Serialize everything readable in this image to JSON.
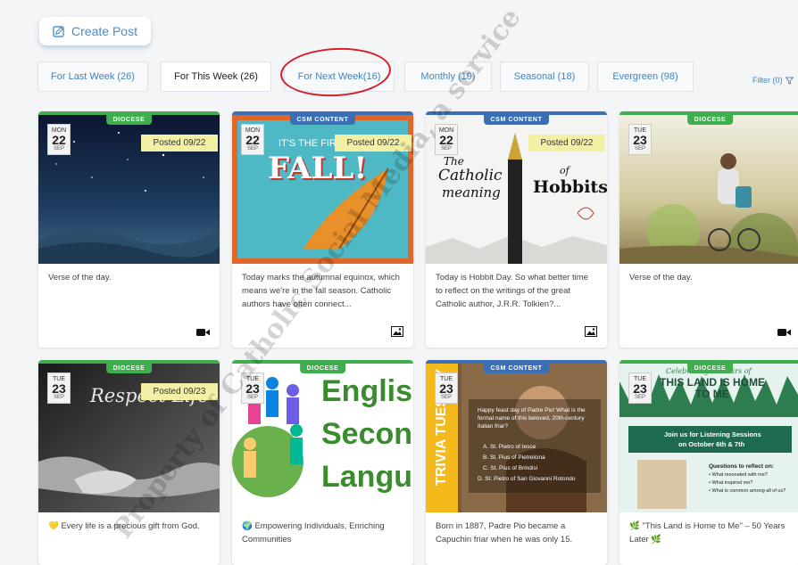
{
  "create_post": {
    "label": "Create Post",
    "icon": "edit-square-icon"
  },
  "tabs": [
    {
      "label": "For Last Week (26)",
      "active": false
    },
    {
      "label": "For This Week (26)",
      "active": true
    },
    {
      "label": "For Next Week(16)",
      "active": false,
      "circled": true
    },
    {
      "label": "Monthly (19)",
      "active": false
    },
    {
      "label": "Seasonal (18)",
      "active": false
    },
    {
      "label": "Evergreen (98)",
      "active": false
    }
  ],
  "filter": {
    "label": "Filter (0)",
    "icon": "funnel-icon"
  },
  "colors": {
    "accent": "#3f85c2",
    "diocese": "#3fae4f",
    "csm": "#3a6fb6",
    "posted_bg": "#f3f0a6",
    "annotation": "#d61f2a"
  },
  "cards": [
    {
      "badge": "DIOCESE",
      "dow": "MON",
      "day": "22",
      "mon": "SEP",
      "posted": "Posted 09/22",
      "caption": "Verse of the day.",
      "media": "video-icon"
    },
    {
      "badge": "CSM CONTENT",
      "dow": "MON",
      "day": "22",
      "mon": "SEP",
      "posted": "Posted 09/22",
      "art_line1": "IT'S THE FIRST",
      "art_line2": "FALL!",
      "caption": "Today marks the autumnal equinox, which means we're in the fall season. Catholic authors have often connect...",
      "media": "image-icon"
    },
    {
      "badge": "CSM CONTENT",
      "dow": "MON",
      "day": "22",
      "mon": "SEP",
      "posted": "Posted 09/22",
      "art_line1": "The",
      "art_line2": "Catholic",
      "art_line3": "meaning",
      "art_line4": "of",
      "art_line5": "Hobbits",
      "caption": "Today is Hobbit Day. So what better time to reflect on the writings of the great Catholic author, J.R.R. Tolkien?...",
      "media": "image-icon"
    },
    {
      "badge": "DIOCESE",
      "dow": "TUE",
      "day": "23",
      "mon": "SEP",
      "posted": "",
      "caption": "Verse of the day.",
      "media": "video-icon"
    },
    {
      "badge": "DIOCESE",
      "dow": "TUE",
      "day": "23",
      "mon": "SEP",
      "posted": "Posted 09/23",
      "art_line1": "Respect Life",
      "caption": "💛 Every life is a precious gift from God."
    },
    {
      "badge": "DIOCESE",
      "dow": "TUE",
      "day": "23",
      "mon": "SEP",
      "posted": "",
      "art_line1": "English",
      "art_line2": "Second",
      "art_line3": "Language",
      "caption": "🌍 Empowering Individuals, Enriching Communities"
    },
    {
      "badge": "CSM CONTENT",
      "dow": "TUE",
      "day": "23",
      "mon": "SEP",
      "posted": "",
      "art_line1": "TRIVIA TUESDAY",
      "art_q": "Happy feast day of Padre Pio! What is the formal name of this beloved, 20th-century Italian friar?",
      "art_a": "A. St. Pietro of Iesce",
      "art_b": "B. St. Pius of Pietrelcina",
      "art_c": "C. St. Pius of Brindisi",
      "art_d": "D. St. Pietro of San Giovanni Rotondo",
      "caption": "Born in 1887, Padre Pio became a Capuchin friar when he was only 15."
    },
    {
      "badge": "DIOCESE",
      "dow": "TUE",
      "day": "23",
      "mon": "SEP",
      "posted": "",
      "art_line1": "Celebrating 50 Years of",
      "art_line2": "THIS LAND IS HOME",
      "art_line3": "TO ME",
      "art_line4": "Join us for Listening Sessions",
      "art_line5": "on October 6th & 7th",
      "art_line6": "Questions to reflect on:",
      "art_b1": "• What resonated with me?",
      "art_b2": "• What inspired me?",
      "art_b3": "• What is common among all of us?",
      "caption": "🌿 \"This Land is Home to Me\" – 50 Years Later 🌿"
    }
  ],
  "watermark": "Property of Catholic Social Media, a service"
}
